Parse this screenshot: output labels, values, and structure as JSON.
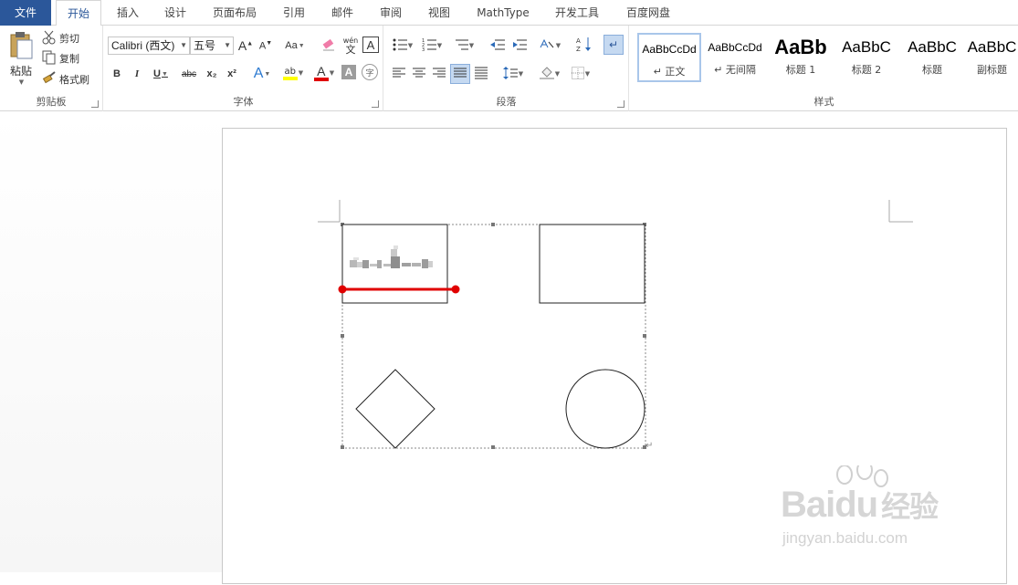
{
  "tabs": [
    "文件",
    "开始",
    "插入",
    "设计",
    "页面布局",
    "引用",
    "邮件",
    "审阅",
    "视图",
    "MathType",
    "开发工具",
    "百度网盘"
  ],
  "clipboard": {
    "paste_label": "粘贴",
    "cut_label": "剪切",
    "copy_label": "复制",
    "painter_label": "格式刷",
    "group_label": "剪贴板"
  },
  "font": {
    "font_name": "Calibri (西文)",
    "font_size": "五号",
    "case_label": "Aa",
    "group_label": "字体",
    "bold": "B",
    "italic": "I",
    "underline": "U",
    "strike": "abc",
    "subscript": "x₂",
    "superscript": "x²",
    "wen_label": "wén",
    "wen_char": "文",
    "a_label": "A",
    "effect_label": "A",
    "highlight_label": "ab",
    "color_label": "A",
    "shade_label": "A",
    "enclose_label": "字"
  },
  "paragraph": {
    "group_label": "段落"
  },
  "styles": {
    "group_label": "样式",
    "items": [
      {
        "sample": "AaBbCcDd",
        "name": "正文",
        "prefix": "↵ "
      },
      {
        "sample": "AaBbCcDd",
        "name": "无间隔",
        "prefix": "↵ "
      },
      {
        "sample": "AaBb",
        "name": "标题 1",
        "prefix": ""
      },
      {
        "sample": "AaBbC",
        "name": "标题 2",
        "prefix": ""
      },
      {
        "sample": "AaBbC",
        "name": "标题",
        "prefix": ""
      },
      {
        "sample": "AaBbC",
        "name": "副标题",
        "prefix": ""
      }
    ]
  },
  "watermark": {
    "brand": "Bai",
    "brand2": "du",
    "brand_cn": "经验",
    "url": "jingyan.baidu.com"
  },
  "colors": {
    "accent": "#2b579a",
    "red_line": "#e00000",
    "highlight": "#ffff00",
    "font_red": "#e00000"
  }
}
